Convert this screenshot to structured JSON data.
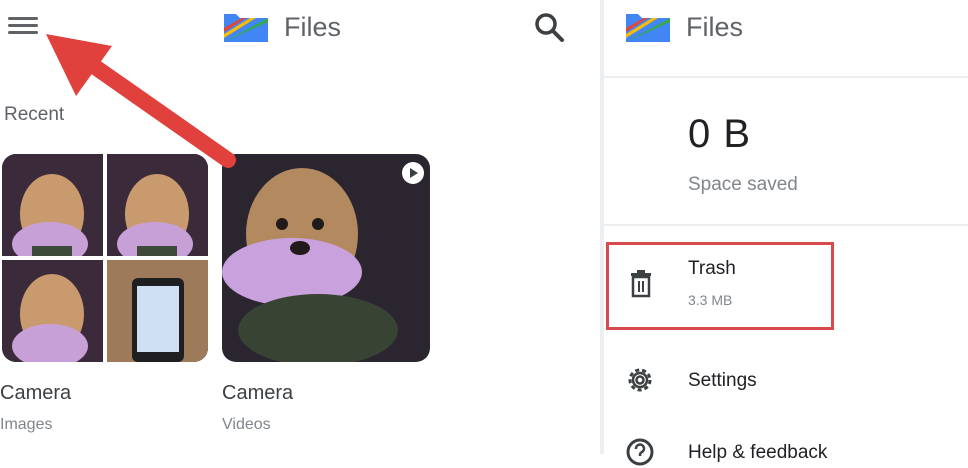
{
  "left_panel": {
    "app_title": "Files",
    "section_label": "Recent",
    "cards": [
      {
        "title": "Camera",
        "subtitle": "Images"
      },
      {
        "title": "Camera",
        "subtitle": "Videos"
      }
    ]
  },
  "right_panel": {
    "app_title": "Files",
    "storage": {
      "value": "0 B",
      "label": "Space saved"
    },
    "menu_items": [
      {
        "label": "Trash",
        "sub": "3.3 MB"
      },
      {
        "label": "Settings"
      },
      {
        "label": "Help & feedback"
      }
    ]
  },
  "colors": {
    "highlight": "#d94a4f",
    "arrow": "#e0413d",
    "logo_blue": "#4285f4",
    "logo_green": "#34a853",
    "logo_yellow": "#fbbc04",
    "logo_red": "#ea4335"
  },
  "icons": {
    "menu": "hamburger-menu-icon",
    "search": "search-icon",
    "trash": "trash-icon",
    "settings": "gear-icon",
    "help": "help-icon",
    "video": "video-play-icon"
  }
}
